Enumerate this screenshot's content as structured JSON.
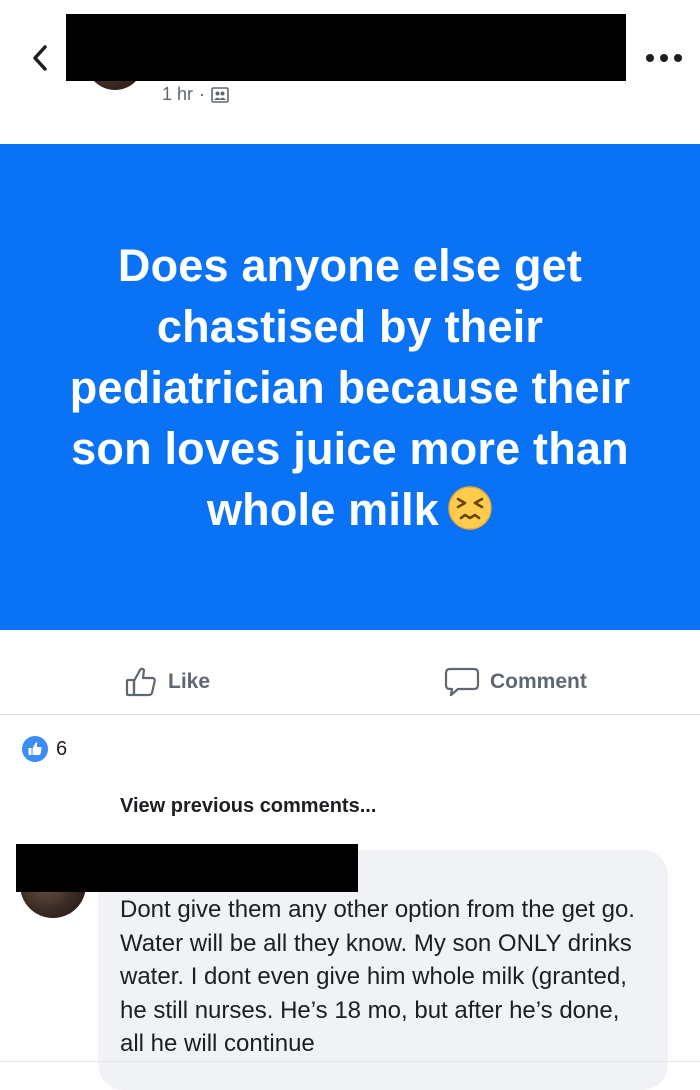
{
  "header": {
    "back_icon": "chevron-left-icon",
    "more_icon": "ellipsis-icon",
    "timestamp": "1 hr",
    "separator": "·",
    "audience_icon": "group-icon"
  },
  "post": {
    "background_color": "#0a73f5",
    "text": "Does anyone else get chastised by their pediatrician because their son loves juice more than whole milk",
    "emoji": "persevering-face-emoji"
  },
  "actions": {
    "like_label": "Like",
    "like_icon": "thumbs-up-outline-icon",
    "comment_label": "Comment",
    "comment_icon": "speech-bubble-icon"
  },
  "reactions": {
    "icon": "like-reaction-icon",
    "count": "6"
  },
  "comments": {
    "view_previous": "View previous comments...",
    "items": [
      {
        "text": "Dont give them any other option from the get go. Water will be all they know. My son ONLY drinks water. I dont even give him whole milk (granted, he still nurses. He’s 18 mo, but after he’s done, all he will continue"
      }
    ]
  }
}
